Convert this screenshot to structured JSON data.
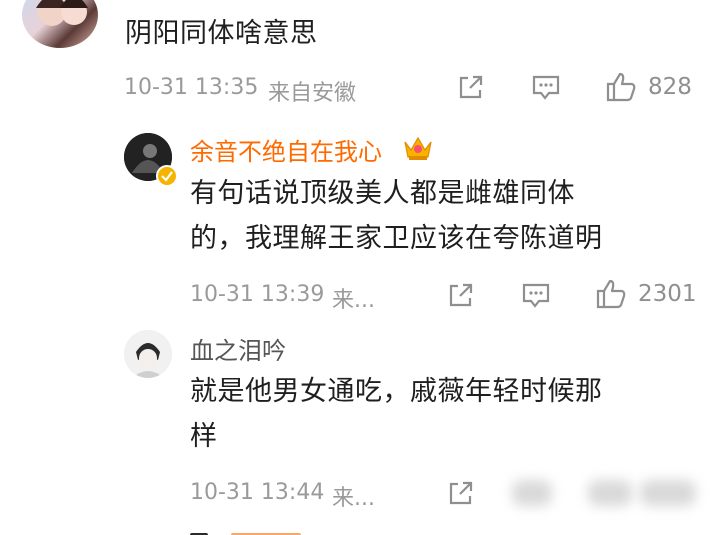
{
  "top_comment": {
    "text": "阴阳同体啥意思",
    "time": "10-31 13:35",
    "location": "来自安徽",
    "likes": "828",
    "icons": {
      "share": "share-icon",
      "comment": "comment-icon",
      "like": "thumbs-up-icon"
    }
  },
  "replies": [
    {
      "username": "余音不绝自在我心",
      "badge": "crown",
      "text_line1": "有句话说顶级美人都是雌雄同体",
      "text_line2": "的，我理解王家卫应该在夸陈道明",
      "time": "10-31 13:39",
      "location": "来...",
      "likes": "2301"
    },
    {
      "username": "血之泪吟",
      "text_line1": "就是他男女通吃，戚薇年轻时候那",
      "text_line2": "样",
      "time": "10-31 13:44",
      "location": "来..."
    }
  ],
  "colors": {
    "vip_name": "#ff6a00",
    "meta_gray": "#9a9a9a",
    "text": "#1f1f1f",
    "verified_badge": "#f4b400"
  }
}
